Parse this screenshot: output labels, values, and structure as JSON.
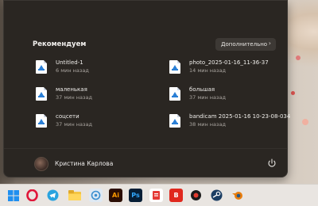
{
  "start_menu": {
    "recommended_title": "Рекомендуем",
    "more_button": "Дополнительно",
    "items": [
      {
        "name": "Untitled-1",
        "time": "6 мин назад"
      },
      {
        "name": "photo_2025-01-16_11-36-37",
        "time": "14 мин назад"
      },
      {
        "name": "маленькая",
        "time": "37 мин назад"
      },
      {
        "name": "большая",
        "time": "37 мин назад"
      },
      {
        "name": "соцсети",
        "time": "37 мин назад"
      },
      {
        "name": "bandicam 2025-01-16 10-23-08-034",
        "time": "38 мин назад"
      }
    ],
    "user_name": "Кристина Карлова"
  },
  "taskbar": {
    "icons": [
      "windows-start-icon",
      "opera-icon",
      "telegram-icon",
      "file-explorer-icon",
      "network-app-icon",
      "illustrator-icon",
      "photoshop-icon",
      "pdf-app-icon",
      "bandicam-icon",
      "media-recorder-icon",
      "steam-icon",
      "blender-icon"
    ],
    "ai_label": "Ai",
    "ps_label": "Ps",
    "b_label": "B"
  },
  "colors": {
    "menu_bg": "#2a2622",
    "accent_blue": "#2a7fd6",
    "taskbar_bg": "#e9e5e1"
  }
}
